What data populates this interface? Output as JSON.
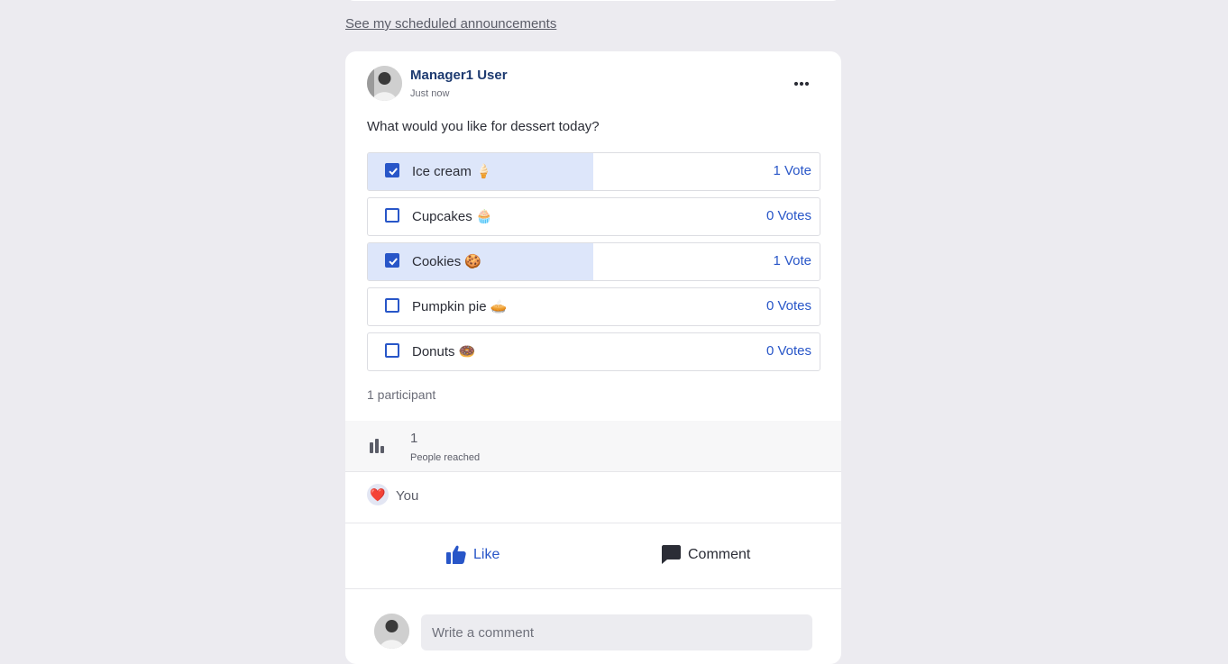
{
  "header": {
    "scheduled_link": "See my scheduled announcements"
  },
  "post": {
    "author": "Manager1 User",
    "timestamp": "Just now",
    "question": "What would you like for dessert today?",
    "options": [
      {
        "label": "Ice cream 🍦",
        "votes": "1 Vote",
        "checked": true,
        "share": 0.5
      },
      {
        "label": "Cupcakes 🧁",
        "votes": "0 Votes",
        "checked": false,
        "share": 0
      },
      {
        "label": "Cookies 🍪",
        "votes": "1 Vote",
        "checked": true,
        "share": 0.5
      },
      {
        "label": "Pumpkin pie 🥧",
        "votes": "0 Votes",
        "checked": false,
        "share": 0
      },
      {
        "label": "Donuts 🍩",
        "votes": "0 Votes",
        "checked": false,
        "share": 0
      }
    ],
    "participants": "1 participant"
  },
  "reach": {
    "count": "1",
    "label": "People reached"
  },
  "reactions": {
    "emoji": "❤️",
    "who": "You"
  },
  "actions": {
    "like": "Like",
    "comment": "Comment"
  },
  "comment_box": {
    "placeholder": "Write a comment"
  },
  "colors": {
    "accent": "#2856c8",
    "fill": "#dde6fa",
    "background": "#ecebf0"
  }
}
